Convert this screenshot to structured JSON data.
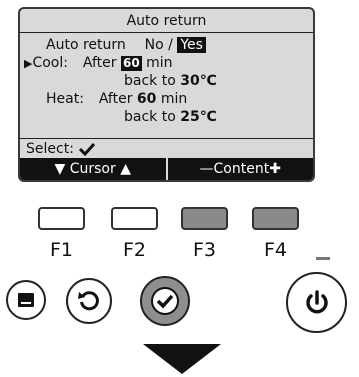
{
  "screen": {
    "title": "Auto return",
    "auto_return": {
      "label": "Auto return",
      "option_no": "No",
      "separator": "/",
      "option_yes": "Yes"
    },
    "cool": {
      "marker": "▶",
      "label": "Cool:",
      "after_text": "After",
      "after_value": "60",
      "after_unit": "min",
      "back_text": "back to",
      "back_value": "30℃"
    },
    "heat": {
      "label": "Heat:",
      "after_text": "After",
      "after_value": "60",
      "after_unit": "min",
      "back_text": "back to",
      "back_value": "25℃"
    },
    "select_label": "Select:",
    "function_bar": {
      "left": "▼ Cursor ▲",
      "right": "—Content✚"
    }
  },
  "buttons": {
    "f1": "F1",
    "f2": "F2",
    "f3": "F3",
    "f4": "F4"
  },
  "icons": {
    "menu": "menu-icon",
    "return": "return-icon",
    "confirm": "check-icon",
    "power": "power-icon",
    "scroll": "down-arrow-icon"
  },
  "colors": {
    "lcd_background": "#d9d9d9",
    "highlight": "#111111",
    "dark_button": "#8e8e8e"
  }
}
